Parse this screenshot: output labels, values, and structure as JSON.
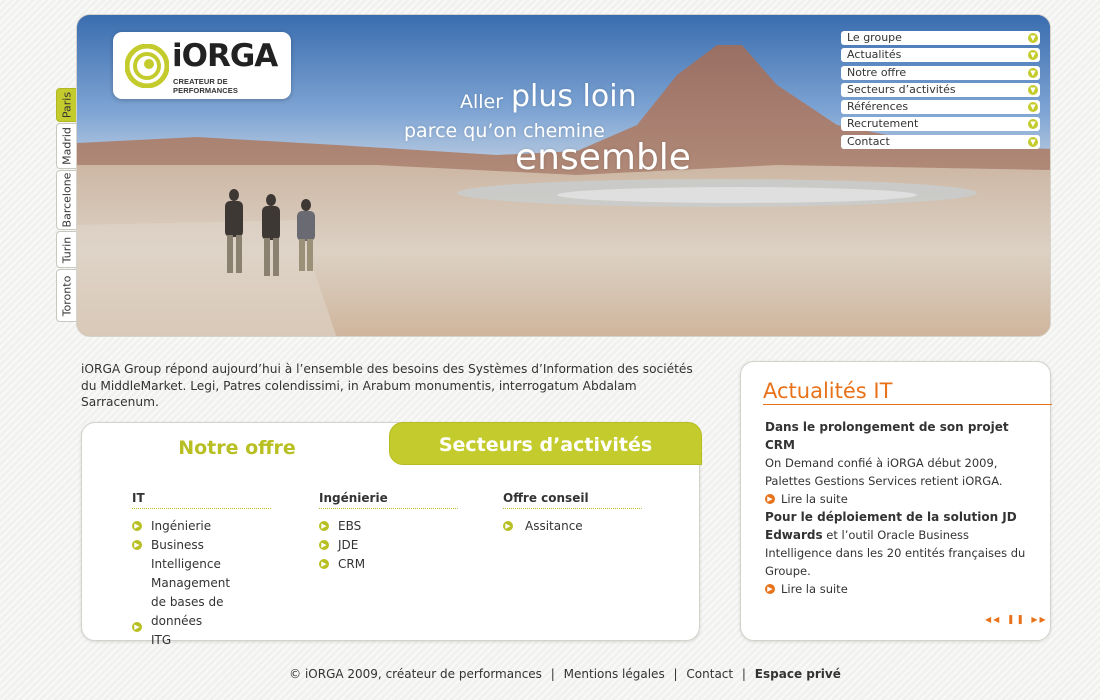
{
  "brand": {
    "name": "iORGA",
    "tagline": "CREATEUR DE PERFORMANCES"
  },
  "slogan": {
    "line1a": "Aller",
    "line1b": "plus loin",
    "line2": "parce qu’on chemine",
    "line3": "ensemble"
  },
  "nav": {
    "items": [
      {
        "label": "Le groupe"
      },
      {
        "label": "Actualités"
      },
      {
        "label": "Notre offre"
      },
      {
        "label": "Secteurs d’activités"
      },
      {
        "label": "Références"
      },
      {
        "label": "Recrutement"
      },
      {
        "label": "Contact"
      }
    ]
  },
  "cities": [
    {
      "label": "Paris",
      "active": true
    },
    {
      "label": "Madrid",
      "active": false
    },
    {
      "label": "Barcelone",
      "active": false
    },
    {
      "label": "Turin",
      "active": false
    },
    {
      "label": "Toronto",
      "active": false
    }
  ],
  "intro": "iORGA Group répond aujourd’hui à l’ensemble des besoins des Systèmes d’Information des sociétés du MiddleMarket. Legi, Patres colendissimi, in Arabum monumentis, interrogatum Abdalam Sarracenum.",
  "offer": {
    "tab_offer": "Notre offre",
    "tab_sectors": "Secteurs d’activités",
    "columns": [
      {
        "title": "IT",
        "items": [
          "Ingénierie",
          "Business Intelligence",
          "Management\nde bases de données",
          "ITG"
        ]
      },
      {
        "title": "Ingénierie",
        "items": [
          "EBS",
          "JDE",
          "CRM"
        ]
      },
      {
        "title": "Offre conseil",
        "items": [
          "Assitance"
        ]
      }
    ]
  },
  "news": {
    "title": "Actualités IT",
    "items": [
      {
        "headline": "Dans le prolongement de son projet CRM",
        "body": "On Demand confié à iORGA début 2009, Palettes Gestions Services retient iORGA.",
        "link": "Lire la suite"
      },
      {
        "headline": "Pour le déploiement de la solution JD Edwards",
        "body": "et l’outil Oracle Business Intelligence dans les 20 entités françaises du Groupe.",
        "link": "Lire la suite"
      }
    ],
    "pager": {
      "prev": "◀◀",
      "pause": "❚❚",
      "next": "▶▶"
    }
  },
  "footer": {
    "copyright": "© iORGA 2009, créateur de performances",
    "legal": "Mentions légales",
    "contact": "Contact",
    "private": "Espace privé",
    "separator": "|"
  },
  "colors": {
    "accent_green": "#c4cb2c",
    "accent_orange": "#e8721a"
  }
}
